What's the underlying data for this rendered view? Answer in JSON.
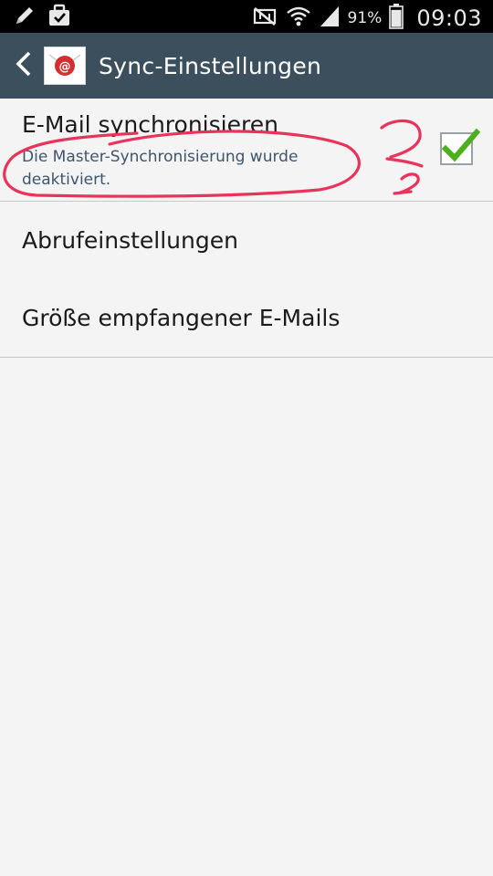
{
  "status_bar": {
    "battery_percent": "91%",
    "time": "09:03",
    "left_icons": [
      "pencil-icon",
      "briefcase-icon"
    ],
    "right_icons": [
      "mute-icon",
      "wifi-icon",
      "signal-icon",
      "battery-icon"
    ],
    "battery_level": 0.91
  },
  "action_bar": {
    "title": "Sync-Einstellungen",
    "back_icon": "chevron-left-icon",
    "app_icon": "email-app-icon",
    "app_icon_colors": {
      "background": "#ffffff",
      "badge": "#d32f2f"
    }
  },
  "settings": {
    "sync_email": {
      "label": "E-Mail synchronisieren",
      "summary": "Die Master-Synchronisierung wurde deaktiviert.",
      "checked": true
    },
    "items": [
      {
        "label": "Abrufeinstellungen"
      },
      {
        "label": "Größe empfangener E-Mails"
      }
    ]
  },
  "annotation": {
    "ink_color": "#e8345c",
    "mark": "2"
  },
  "colors": {
    "action_bar": "#3b4f5c",
    "background": "#f4f4f4",
    "summary_text": "#3e556a",
    "check": "#4caf1e"
  }
}
